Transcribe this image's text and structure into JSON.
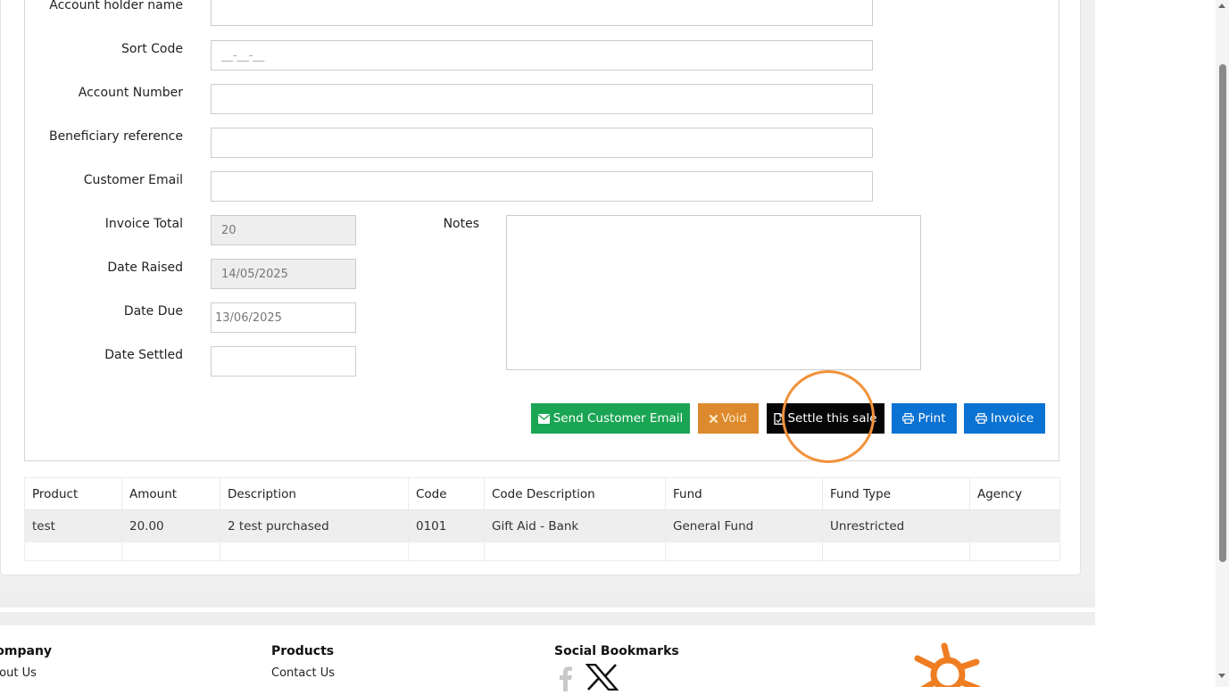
{
  "form": {
    "account_holder_label": "Account holder name",
    "account_holder_value": "",
    "sort_code_label": "Sort Code",
    "sort_code_placeholder": "__-__-__",
    "account_number_label": "Account Number",
    "account_number_value": "",
    "beneficiary_label": "Beneficiary reference",
    "beneficiary_value": "",
    "customer_email_label": "Customer Email",
    "customer_email_value": "",
    "invoice_total_label": "Invoice Total",
    "invoice_total_value": "20",
    "date_raised_label": "Date Raised",
    "date_raised_value": "14/05/2025",
    "date_due_label": "Date Due",
    "date_due_value": "13/06/2025",
    "date_settled_label": "Date Settled",
    "date_settled_value": "",
    "notes_label": "Notes"
  },
  "actions": {
    "send_email": "Send Customer Email",
    "void": "Void",
    "settle": "Settle this sale",
    "print": "Print",
    "invoice": "Invoice"
  },
  "table": {
    "columns": [
      "Product",
      "Amount",
      "Description",
      "Code",
      "Code Description",
      "Fund",
      "Fund Type",
      "Agency"
    ],
    "rows": [
      [
        "test",
        "20.00",
        "2 test purchased",
        "0101",
        "Gift Aid - Bank",
        "General Fund",
        "Unrestricted",
        ""
      ]
    ]
  },
  "footer": {
    "company_heading": "Company",
    "about_link": "About Us",
    "products_heading": "Products",
    "contact_link": "Contact Us",
    "social_heading": "Social Bookmarks"
  },
  "colors": {
    "green": "#1aa554",
    "orange": "#dd8a2e",
    "black": "#050505",
    "blue": "#0a72d2",
    "highlight": "#f2913a",
    "logo": "#ef7d22"
  },
  "icons": {
    "send_email": "envelope-icon",
    "void": "x-icon",
    "settle": "document-icon",
    "print": "printer-icon",
    "invoice": "printer-icon",
    "social_1": "facebook-icon",
    "social_2": "x-twitter-icon",
    "brand": "sun-logo-icon"
  }
}
